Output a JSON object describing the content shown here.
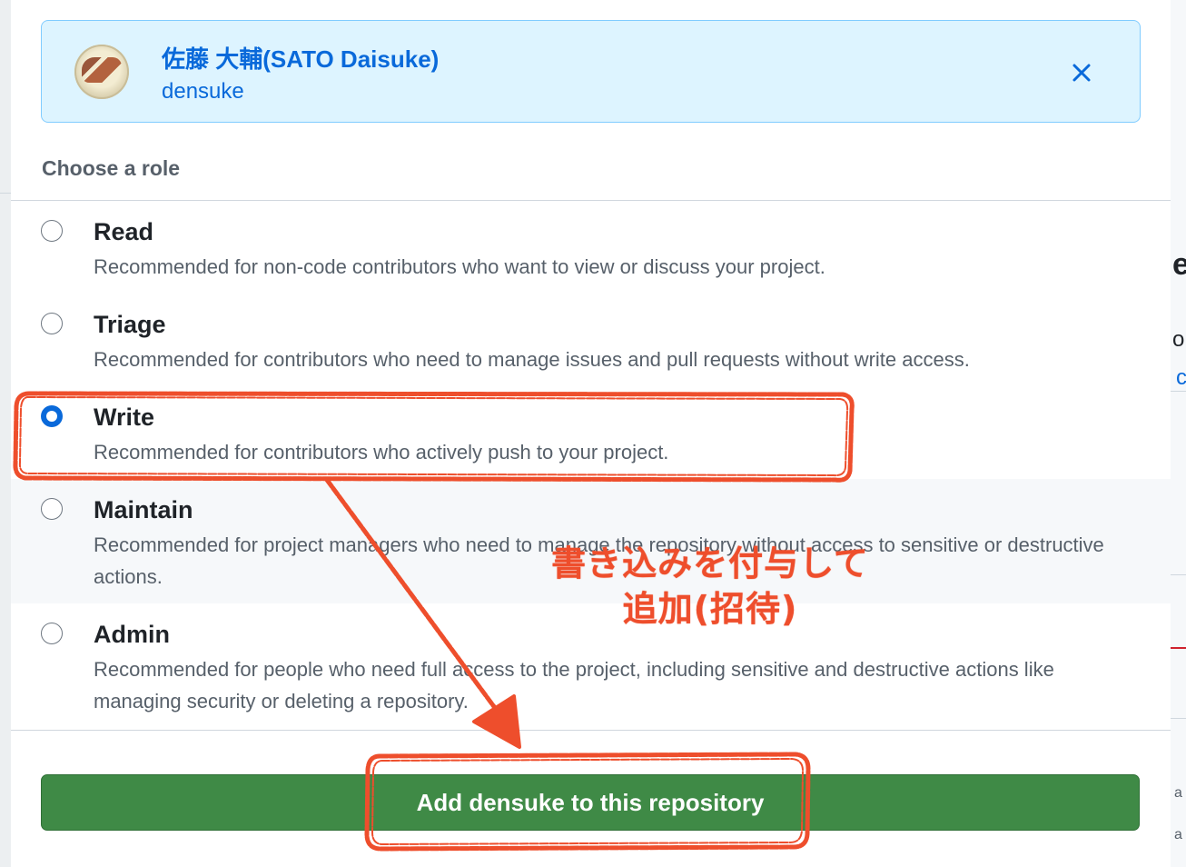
{
  "background_fragments": {
    "heading_fragment": "e",
    "text_fragment": "o",
    "link_fragment": "c",
    "small_fragment_1": "a",
    "small_fragment_2": "a"
  },
  "user": {
    "display_name": "佐藤 大輔(SATO Daisuke)",
    "login": "densuke"
  },
  "close_label": "×",
  "role_heading": "Choose a role",
  "roles": [
    {
      "title": "Read",
      "description": "Recommended for non-code contributors who want to view or discuss your project.",
      "selected": false
    },
    {
      "title": "Triage",
      "description": "Recommended for contributors who need to manage issues and pull requests without write access.",
      "selected": false
    },
    {
      "title": "Write",
      "description": "Recommended for contributors who actively push to your project.",
      "selected": true
    },
    {
      "title": "Maintain",
      "description": "Recommended for project managers who need to manage the repository without access to sensitive or destructive actions.",
      "selected": false
    },
    {
      "title": "Admin",
      "description": "Recommended for people who need full access to the project, including sensitive and destructive actions like managing security or deleting a repository.",
      "selected": false
    }
  ],
  "add_button_label": "Add densuke to this repository",
  "annotation": {
    "line1": "書き込みを付与して",
    "line2": "追加(招待)",
    "color": "#ee4e2c"
  },
  "colors": {
    "accent": "#0969da",
    "button_green": "#3f8a46",
    "card_bg": "#ddf4ff"
  }
}
